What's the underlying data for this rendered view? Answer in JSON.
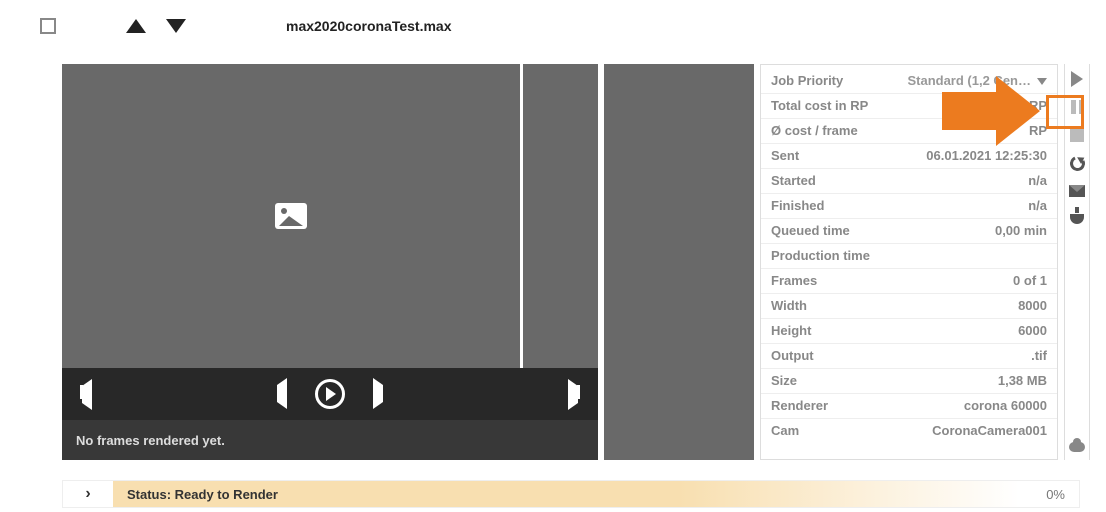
{
  "header": {
    "filename": "max2020coronaTest.max"
  },
  "viewer": {
    "no_frames_msg": "No frames rendered yet."
  },
  "info": {
    "priority_label": "Job Priority",
    "priority_value": "Standard (1,2 Cen…",
    "total_cost_label": "Total cost in RP",
    "total_cost_value": "RP",
    "avg_cost_label": "Ø cost / frame",
    "avg_cost_value": "RP",
    "sent_label": "Sent",
    "sent_value": "06.01.2021 12:25:30",
    "started_label": "Started",
    "started_value": "n/a",
    "finished_label": "Finished",
    "finished_value": "n/a",
    "queued_label": "Queued time",
    "queued_value": "0,00 min",
    "production_label": "Production time",
    "production_value": "",
    "frames_label": "Frames",
    "frames_value": "0 of 1",
    "width_label": "Width",
    "width_value": "8000",
    "height_label": "Height",
    "height_value": "6000",
    "output_label": "Output",
    "output_value": ".tif",
    "size_label": "Size",
    "size_value": "1,38 MB",
    "renderer_label": "Renderer",
    "renderer_value": "corona 60000",
    "cam_label": "Cam",
    "cam_value": "CoronaCamera001"
  },
  "status": {
    "label": "Status: Ready to Render",
    "percent": "0%"
  }
}
